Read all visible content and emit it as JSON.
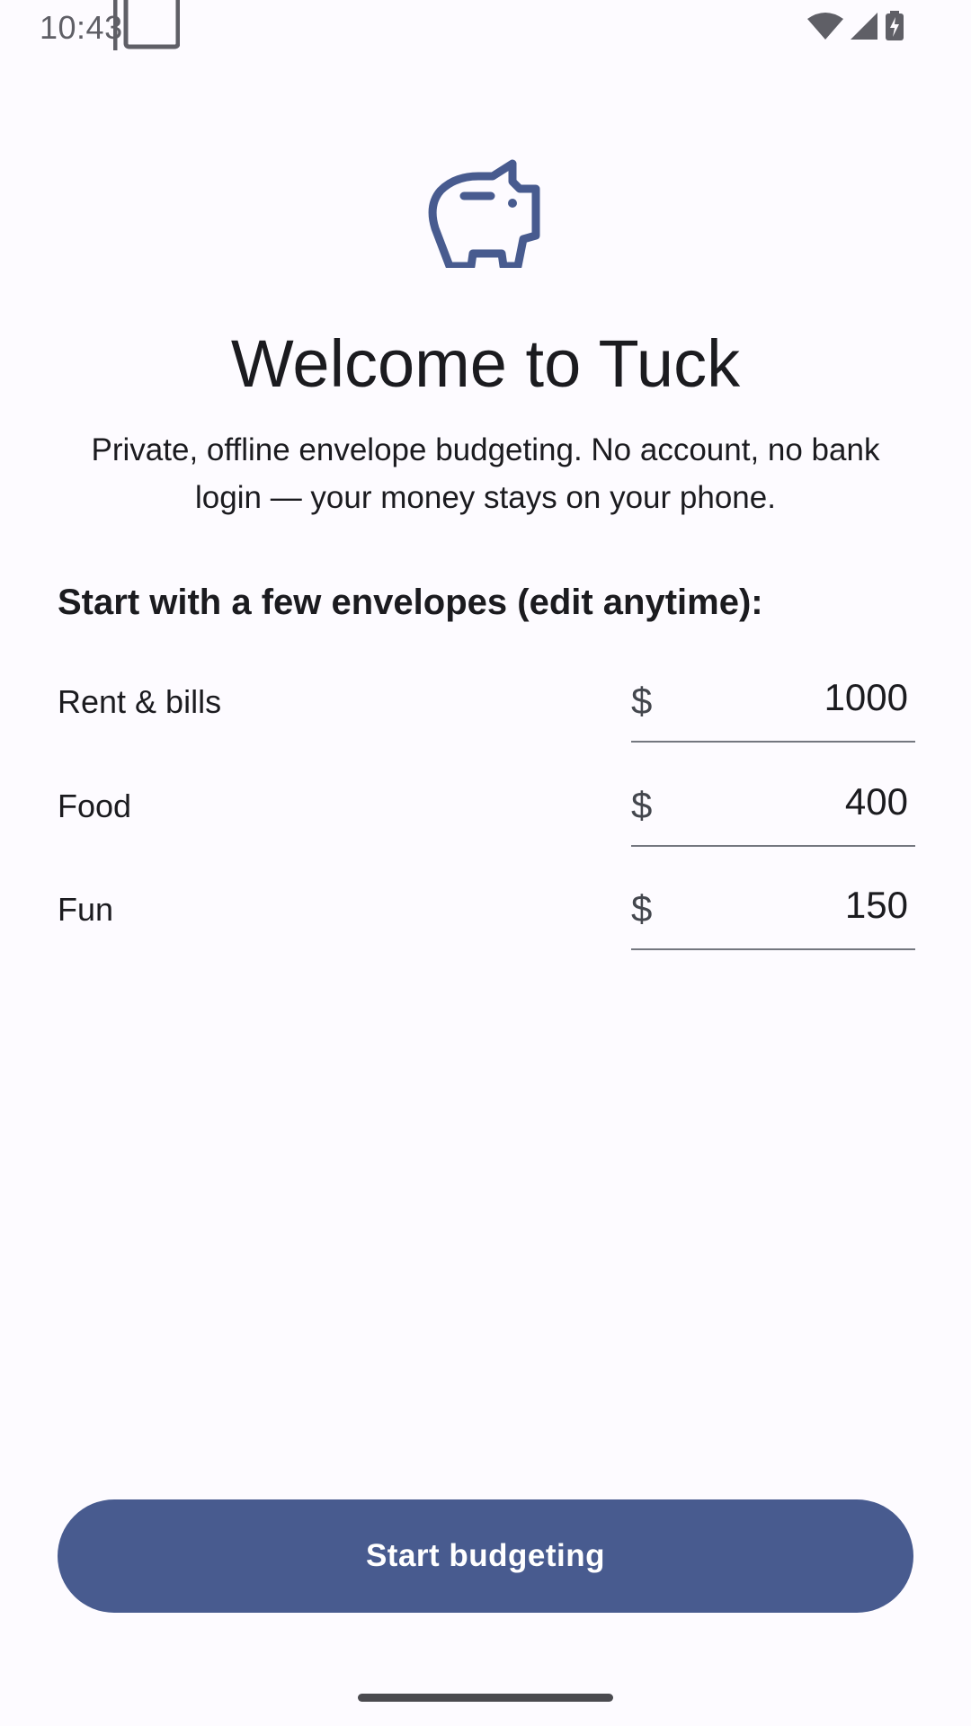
{
  "status_bar": {
    "time": "10:43",
    "icons": [
      "notification-placeholder-icon",
      "wifi-icon",
      "cellular-signal-icon",
      "battery-charging-icon"
    ]
  },
  "logo": {
    "icon": "piggy-bank-icon",
    "color": "#485b8f"
  },
  "welcome": {
    "title": "Welcome to Tuck",
    "subtitle": "Private, offline envelope budgeting. No account, no bank login — your money stays on your phone."
  },
  "envelopes": {
    "heading": "Start with a few envelopes (edit anytime):",
    "currency_symbol": "$",
    "items": [
      {
        "name": "Rent & bills",
        "amount": "1000"
      },
      {
        "name": "Food",
        "amount": "400"
      },
      {
        "name": "Fun",
        "amount": "150"
      }
    ]
  },
  "actions": {
    "start_label": "Start budgeting",
    "accent_color": "#485b8f"
  }
}
